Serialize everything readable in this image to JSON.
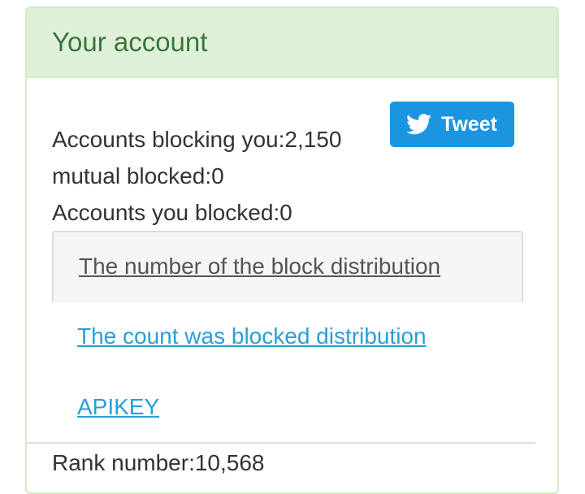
{
  "panel": {
    "title": "Your account"
  },
  "stats": {
    "blocking_you": "Accounts blocking you:2,150",
    "mutual_blocked": "mutual blocked:0",
    "you_blocked": "Accounts you blocked:0",
    "rank": "Rank number:10,568"
  },
  "tweet_button": {
    "label": "Tweet",
    "icon": "twitter-bird-icon",
    "color": "#1b95e0"
  },
  "tabs": [
    {
      "label": "The number of the block distribution",
      "active": true
    },
    {
      "label": "The count was blocked distribution",
      "active": false
    },
    {
      "label": "APIKEY",
      "active": false
    }
  ],
  "colors": {
    "heading_bg": "#dff0d8",
    "heading_text": "#3c763d",
    "link": "#2a9fd6"
  }
}
